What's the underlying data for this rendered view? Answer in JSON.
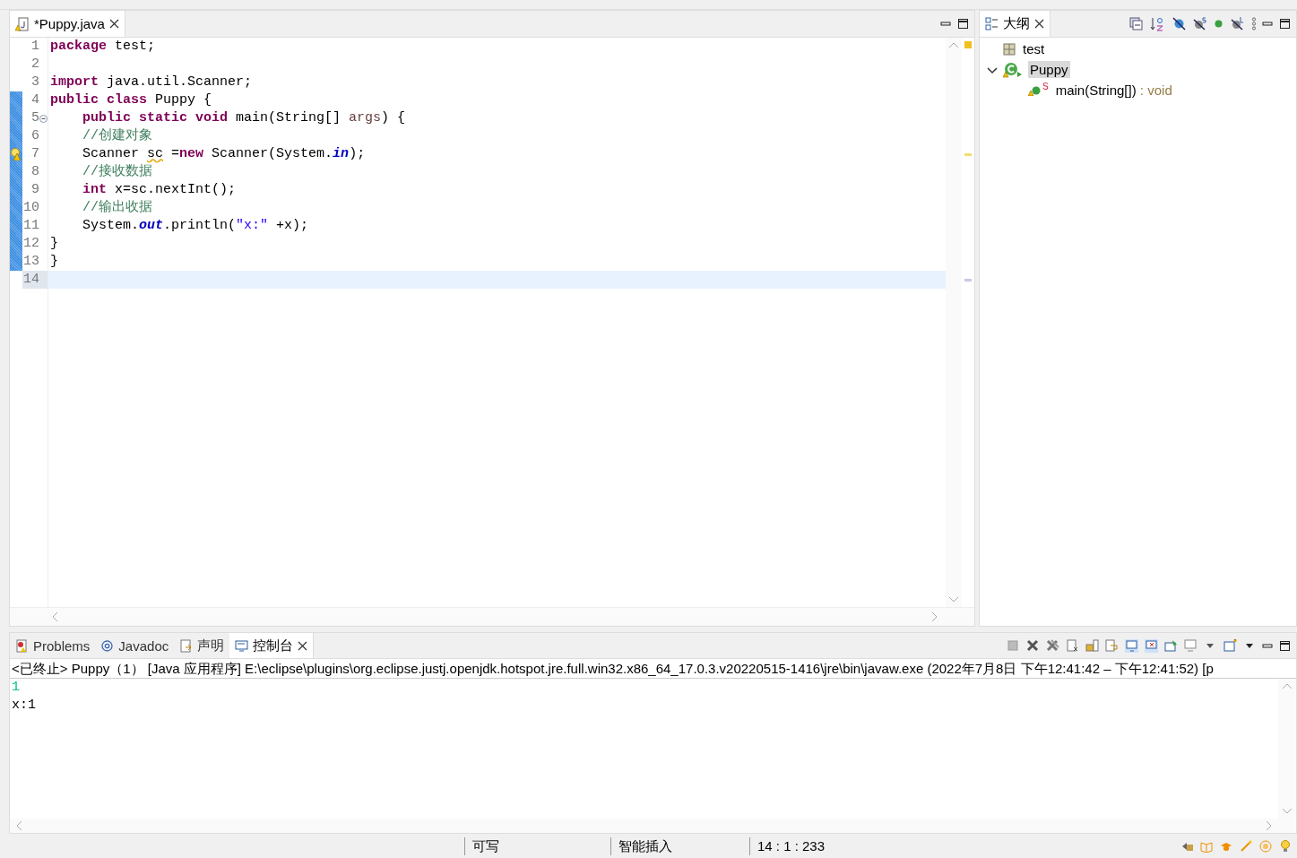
{
  "editor": {
    "tab": {
      "title": "*Puppy.java",
      "selected": true
    },
    "lines": [
      {
        "number": "1",
        "changed": false,
        "current": false,
        "foldable": false,
        "warning": false,
        "tokens": [
          {
            "kind": "keyword",
            "text": "package"
          },
          {
            "kind": "plain",
            "text": " test;"
          }
        ]
      },
      {
        "number": "2",
        "changed": false,
        "current": false,
        "foldable": false,
        "warning": false
      },
      {
        "number": "3",
        "changed": false,
        "current": false,
        "foldable": false,
        "warning": false,
        "tokens": [
          {
            "kind": "keyword",
            "text": "import"
          },
          {
            "kind": "plain",
            "text": " java.util.Scanner;"
          }
        ]
      },
      {
        "number": "4",
        "changed": true,
        "current": false,
        "foldable": false,
        "warning": false,
        "tokens": [
          {
            "kind": "keyword",
            "text": "public class"
          },
          {
            "kind": "plain",
            "text": " Puppy {"
          }
        ]
      },
      {
        "number": "5",
        "changed": true,
        "current": false,
        "foldable": true,
        "warning": false,
        "tokens": [
          {
            "kind": "keyword",
            "text": "    public static void"
          },
          {
            "kind": "plain",
            "text": " main(String[] "
          },
          {
            "kind": "parameter",
            "text": "args"
          },
          {
            "kind": "plain",
            "text": ") {"
          }
        ]
      },
      {
        "number": "6",
        "changed": true,
        "current": false,
        "foldable": false,
        "warning": false,
        "tokens": [
          {
            "kind": "comment",
            "text": "    //创建对象"
          }
        ]
      },
      {
        "number": "7",
        "changed": true,
        "current": false,
        "foldable": false,
        "warning": true,
        "tokens": [
          {
            "kind": "plain",
            "text": "    Scanner "
          },
          {
            "kind": "warned",
            "text": "sc"
          },
          {
            "kind": "plain",
            "text": " ="
          },
          {
            "kind": "keyword",
            "text": "new"
          },
          {
            "kind": "plain",
            "text": " Scanner(System."
          },
          {
            "kind": "field",
            "text": "in"
          },
          {
            "kind": "plain",
            "text": ");"
          }
        ]
      },
      {
        "number": "8",
        "changed": true,
        "current": false,
        "foldable": false,
        "warning": false,
        "tokens": [
          {
            "kind": "comment",
            "text": "    //接收数据"
          }
        ]
      },
      {
        "number": "9",
        "changed": true,
        "current": false,
        "foldable": false,
        "warning": false,
        "tokens": [
          {
            "kind": "keyword",
            "text": "    int"
          },
          {
            "kind": "plain",
            "text": " x=sc.nextInt();"
          }
        ]
      },
      {
        "number": "10",
        "changed": true,
        "current": false,
        "foldable": false,
        "warning": false,
        "tokens": [
          {
            "kind": "comment",
            "text": "    //输出收据"
          }
        ]
      },
      {
        "number": "11",
        "changed": true,
        "current": false,
        "foldable": false,
        "warning": false,
        "tokens": [
          {
            "kind": "plain",
            "text": "    System."
          },
          {
            "kind": "field",
            "text": "out"
          },
          {
            "kind": "plain",
            "text": ".println("
          },
          {
            "kind": "string",
            "text": "\"x:\""
          },
          {
            "kind": "plain",
            "text": " +x);"
          }
        ]
      },
      {
        "number": "12",
        "changed": true,
        "current": false,
        "foldable": false,
        "warning": false,
        "tokens": [
          {
            "kind": "plain",
            "text": "}"
          }
        ]
      },
      {
        "number": "13",
        "changed": true,
        "current": false,
        "foldable": false,
        "warning": false,
        "tokens": [
          {
            "kind": "plain",
            "text": "}"
          }
        ]
      },
      {
        "number": "14",
        "changed": false,
        "current": true,
        "foldable": false,
        "warning": false
      }
    ]
  },
  "outline": {
    "tab": {
      "title": "大纲",
      "selected": true
    },
    "items": [
      {
        "kind": "package",
        "label": "test",
        "selected": false
      },
      {
        "kind": "class",
        "label": "Puppy",
        "selected": true,
        "expanded": true,
        "children": [
          {
            "kind": "method",
            "modifier": "S",
            "label": "main(String[])",
            "type": " : void",
            "selected": false
          }
        ]
      }
    ]
  },
  "console": {
    "tabs": [
      {
        "kind": "problems",
        "label": "Problems",
        "selected": false
      },
      {
        "kind": "javadoc",
        "label": "Javadoc",
        "selected": false
      },
      {
        "kind": "declaration",
        "label": "声明",
        "selected": false
      },
      {
        "kind": "console",
        "label": "控制台",
        "selected": true
      }
    ],
    "header": "<已终止> Puppy（1）  [Java 应用程序] E:\\eclipse\\plugins\\org.eclipse.justj.openjdk.hotspot.jre.full.win32.x86_64_17.0.3.v20220515-1416\\jre\\bin\\javaw.exe  (2022年7月8日 下午12:41:42 – 下午12:41:52) [p",
    "output": [
      {
        "kind": "input",
        "text": "1"
      },
      {
        "kind": "output",
        "text": "x:1"
      }
    ]
  },
  "status_bar": {
    "items": [
      "可写",
      "智能插入",
      "14 : 1 : 233"
    ]
  }
}
